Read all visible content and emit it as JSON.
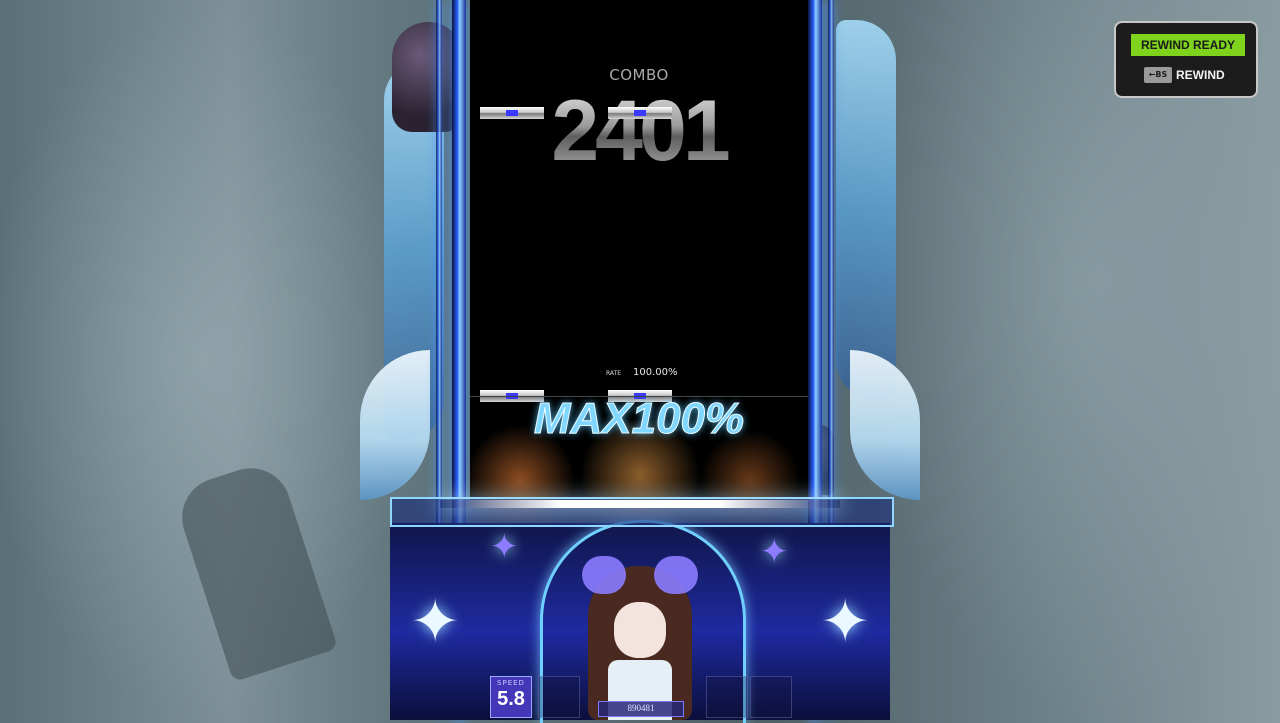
{
  "playfield": {
    "combo_label": "COMBO",
    "combo_value": "2401",
    "rate_label": "RATE",
    "rate_value": "100.00%",
    "judgement_text": "MAX100%"
  },
  "hud": {
    "speed_label": "SPEED",
    "speed_value": "5.8",
    "score_value": "890481"
  },
  "rewind": {
    "status": "REWIND READY",
    "key_label": "←BS",
    "action_label": "REWIND",
    "status_color": "#7fd31c"
  },
  "icons": [
    "note-icon",
    "sparkle-star-icon",
    "backspace-key-icon"
  ]
}
